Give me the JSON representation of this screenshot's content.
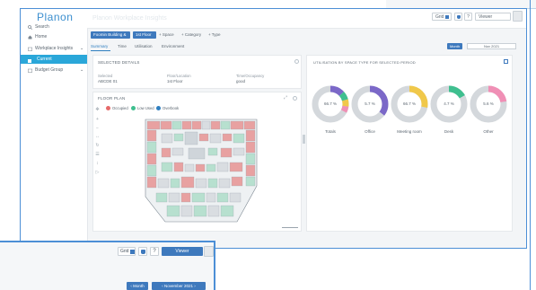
{
  "app": {
    "logo": "Planon"
  },
  "sidebar": {
    "search": "Search",
    "home": "Home",
    "workplace": "Workplace Insights",
    "current": "Current",
    "budget": "Budget Group"
  },
  "header": {
    "ghost_title": "Planon Workplace Insights",
    "view_label": "Grid",
    "user_label": "Viewer"
  },
  "filters": {
    "chip1": "Foomin Building & Shift",
    "chip2": "1st Floor",
    "space": "Space",
    "category": "Category",
    "type": "Type"
  },
  "tabs": [
    "Summary",
    "Time",
    "Utilisation",
    "Environment"
  ],
  "controls": {
    "month_button": "Month",
    "date_range": "Nov 2021"
  },
  "selected_details": {
    "title": "SELECTED DETAILS",
    "col1_label": "Selected",
    "col1_value": "ABCDE 01",
    "col2_label": "Floor/Location",
    "col2_value": "1st Floor",
    "col3_label": "Time/Occupancy",
    "col3_value": "good"
  },
  "floor_plan": {
    "title": "FLOOR PLAN",
    "legend": [
      {
        "label": "Occupied",
        "color": "#e66a6a"
      },
      {
        "label": "Low Used",
        "color": "#3fbf8f"
      },
      {
        "label": "Overbook",
        "color": "#2f7fc0"
      }
    ]
  },
  "utilisation": {
    "title": "UTILISATION BY SPACE TYPE FOR SELECTED PERIOD",
    "donuts": [
      {
        "label": "Totals",
        "value": "66.7 %"
      },
      {
        "label": "Office",
        "value": "5.7 %"
      },
      {
        "label": "Meeting room",
        "value": "66.7 %"
      },
      {
        "label": "Desk",
        "value": "4.7 %"
      },
      {
        "label": "Other",
        "value": "5.6 %"
      }
    ]
  },
  "bottom_window": {
    "view_label": "Grid",
    "user_label": "Viewer",
    "month_button": "Month",
    "date_range": "November 2021"
  }
}
